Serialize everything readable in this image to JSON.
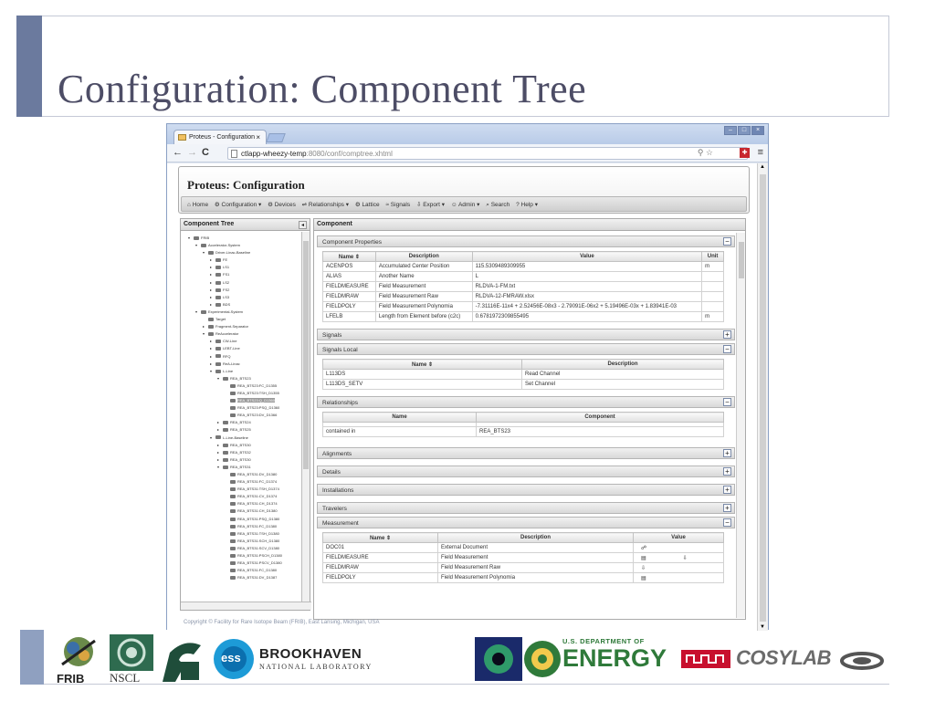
{
  "slide": {
    "title": "Configuration: Component Tree"
  },
  "browser": {
    "tab_title": "Proteus - Configuration",
    "tab_close": "×",
    "url_host": "ctlapp-wheezy-temp",
    "url_rest": ":8080/conf/comptree.xhtml",
    "window_buttons": [
      "–",
      "□",
      "×"
    ]
  },
  "app": {
    "title": "Proteus: Configuration",
    "menu": [
      "⌂ Home",
      "⚙ Configuration ▾",
      "⚙ Devices",
      "⇌ Relationships ▾",
      "⚙ Lattice",
      "≈ Signals",
      "⇩ Export ▾",
      "☺ Admin ▾",
      "⌕ Search",
      "? Help ▾"
    ]
  },
  "tree": {
    "header": "Component Tree",
    "rows": [
      {
        "indent": 0,
        "toggle": "▾",
        "label": "FRIB"
      },
      {
        "indent": 1,
        "toggle": "▾",
        "label": "Accelerator-System"
      },
      {
        "indent": 2,
        "toggle": "▾",
        "label": "Driver-Linac-Baseline"
      },
      {
        "indent": 3,
        "toggle": "▸",
        "label": "FE"
      },
      {
        "indent": 3,
        "toggle": "▸",
        "label": "LS1"
      },
      {
        "indent": 3,
        "toggle": "▸",
        "label": "FS1"
      },
      {
        "indent": 3,
        "toggle": "▸",
        "label": "LS2"
      },
      {
        "indent": 3,
        "toggle": "▸",
        "label": "FS2"
      },
      {
        "indent": 3,
        "toggle": "▸",
        "label": "LS3"
      },
      {
        "indent": 3,
        "toggle": "▸",
        "label": "BDS"
      },
      {
        "indent": 1,
        "toggle": "▾",
        "label": "Experimental-System"
      },
      {
        "indent": 2,
        "toggle": "",
        "label": "Target"
      },
      {
        "indent": 2,
        "toggle": "▸",
        "label": "Fragment-Separator"
      },
      {
        "indent": 2,
        "toggle": "▾",
        "label": "ReAccelerator"
      },
      {
        "indent": 3,
        "toggle": "▸",
        "label": "CW-Line"
      },
      {
        "indent": 3,
        "toggle": "▸",
        "label": "LEBT-Line"
      },
      {
        "indent": 3,
        "toggle": "▸",
        "label": "RFQ"
      },
      {
        "indent": 3,
        "toggle": "▸",
        "label": "ReA-Linac"
      },
      {
        "indent": 3,
        "toggle": "▾",
        "label": "L-Line"
      },
      {
        "indent": 4,
        "toggle": "▾",
        "label": "REA_BTS23"
      },
      {
        "indent": 5,
        "toggle": "",
        "label": "REA_BTS23:FC_D1355"
      },
      {
        "indent": 5,
        "toggle": "",
        "label": "REA_BTS23:TSH_D1355"
      },
      {
        "indent": 5,
        "toggle": "",
        "label": "REA_BTS23:Q_D1360",
        "selected": true
      },
      {
        "indent": 5,
        "toggle": "",
        "label": "REA_BTS23:PSQ_D1360"
      },
      {
        "indent": 5,
        "toggle": "",
        "label": "REA_BTS23:DV_D1366"
      },
      {
        "indent": 4,
        "toggle": "▸",
        "label": "REA_BTS24"
      },
      {
        "indent": 4,
        "toggle": "▸",
        "label": "REA_BTS25"
      },
      {
        "indent": 3,
        "toggle": "▾",
        "label": "L-Line-Baseline"
      },
      {
        "indent": 4,
        "toggle": "▸",
        "label": "REA_BTS30"
      },
      {
        "indent": 4,
        "toggle": "▸",
        "label": "REA_BTS32"
      },
      {
        "indent": 4,
        "toggle": "▸",
        "label": "REA_BTS30"
      },
      {
        "indent": 4,
        "toggle": "▾",
        "label": "REA_BTS31"
      },
      {
        "indent": 5,
        "toggle": "",
        "label": "REA_BTS31:DV_D1380"
      },
      {
        "indent": 5,
        "toggle": "",
        "label": "REA_BTS31:FC_D1374"
      },
      {
        "indent": 5,
        "toggle": "",
        "label": "REA_BTS31:TSH_D1374"
      },
      {
        "indent": 5,
        "toggle": "",
        "label": "REA_BTS31:CV_D1374"
      },
      {
        "indent": 5,
        "toggle": "",
        "label": "REA_BTS31:CH_D1374"
      },
      {
        "indent": 5,
        "toggle": "",
        "label": "REA_BTS31:CH_D1380"
      },
      {
        "indent": 5,
        "toggle": "",
        "label": "REA_BTS31:PSQ_D1380"
      },
      {
        "indent": 5,
        "toggle": "",
        "label": "REA_BTS31:FC_D1380"
      },
      {
        "indent": 5,
        "toggle": "",
        "label": "REA_BTS31:TSH_D1380"
      },
      {
        "indent": 5,
        "toggle": "",
        "label": "REA_BTS31:SCH_D1380"
      },
      {
        "indent": 5,
        "toggle": "",
        "label": "REA_BTS31:SCV_D1380"
      },
      {
        "indent": 5,
        "toggle": "",
        "label": "REA_BTS31:PSCH_D1380"
      },
      {
        "indent": 5,
        "toggle": "",
        "label": "REA_BTS31:PSCV_D1380"
      },
      {
        "indent": 5,
        "toggle": "",
        "label": "REA_BTS31:FC_D1380"
      },
      {
        "indent": 5,
        "toggle": "",
        "label": "REA_BTS31:DV_D1387"
      }
    ]
  },
  "component": {
    "header": "Component",
    "properties": {
      "title": "Component Properties",
      "columns": [
        "Name ⇕",
        "Description",
        "Value",
        "Unit"
      ],
      "rows": [
        [
          "ACENPOS",
          "Accumulated Center Position",
          "115.5309489309955",
          "m"
        ],
        [
          "ALIAS",
          "Another Name",
          "L",
          ""
        ],
        [
          "FIELDMEASURE",
          "Field Measurement",
          "RLDVA-1-FM.txt",
          ""
        ],
        [
          "FIELDMRAW",
          "Field Measurement Raw",
          "RLDVA-12-FMRAW.xlsx",
          ""
        ],
        [
          "FIELDPOLY",
          "Field Measurement Polynomia",
          "-7.31116E-11x4 + 2.52456E-08x3 - 2.79091E-06x2 + 5.19496E-03x + 1.83941E-03",
          ""
        ],
        [
          "LFELB",
          "Length from Element before (c2c)",
          "0.6781972309855495",
          "m"
        ]
      ]
    },
    "signals": {
      "title": "Signals"
    },
    "signals_local": {
      "title": "Signals Local",
      "columns": [
        "Name ⇕",
        "Description"
      ],
      "rows": [
        [
          "L113DS",
          "Read Channel"
        ],
        [
          "L113DS_SETV",
          "Set Channel"
        ]
      ]
    },
    "relationships": {
      "title": "Relationships",
      "columns": [
        "Name",
        "Component"
      ],
      "rows": [
        [
          "contained in",
          "REA_BTS23"
        ]
      ]
    },
    "collapsed_sections": [
      "Alignments",
      "Details",
      "Installations",
      "Travelers"
    ],
    "measurement": {
      "title": "Measurement",
      "columns": [
        "Name ⇕",
        "Description",
        "Value"
      ],
      "rows": [
        [
          "DOC01",
          "External Document",
          "☍",
          ""
        ],
        [
          "FIELDMEASURE",
          "Field Measurement",
          "▤",
          "⇩"
        ],
        [
          "FIELDMRAW",
          "Field Measurement Raw",
          "⇩",
          ""
        ],
        [
          "FIELDPOLY",
          "Field Measurement Polynomia",
          "▤",
          ""
        ]
      ]
    }
  },
  "copyright": "Copyright © Facility for Rare Isotope Beam (FRIB), East Lansing, Michigan, USA",
  "logos": {
    "frib": "FRIB",
    "nscl": "NSCL",
    "ess": "ess",
    "brookhaven_1": "BROOKHAVEN",
    "brookhaven_2": "NATIONAL LABORATORY",
    "doe_small": "U.S. DEPARTMENT OF",
    "doe_big": "ENERGY",
    "cosylab": "COSYLAB"
  }
}
